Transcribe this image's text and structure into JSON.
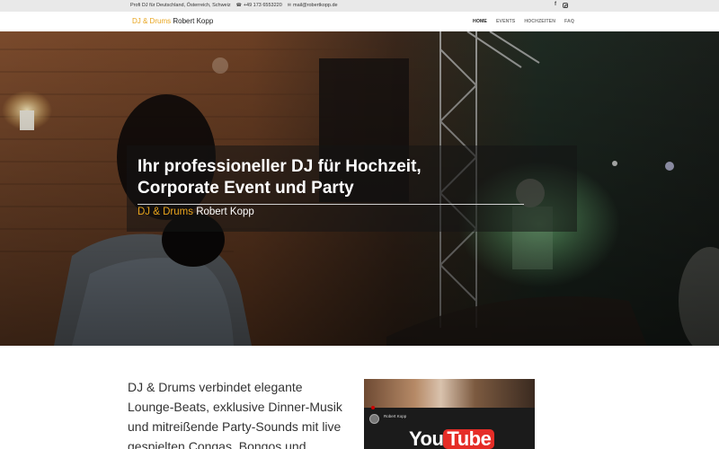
{
  "topbar": {
    "tagline": "Profi DJ für Deutschland, Österreich, Schweiz",
    "phone": "+49 173 6553220",
    "email": "mail@robertkopp.de",
    "phone_icon": "phone-icon",
    "email_icon": "envelope-icon",
    "social": [
      "facebook-icon",
      "instagram-icon"
    ]
  },
  "header": {
    "logo_dj": "DJ & Drums",
    "logo_name": "Robert Kopp",
    "nav": [
      {
        "label": "HOME",
        "active": true
      },
      {
        "label": "EVENTS",
        "active": false
      },
      {
        "label": "HOCHZEITEN",
        "active": false
      },
      {
        "label": "FAQ",
        "active": false
      }
    ]
  },
  "hero": {
    "title": "Ihr professioneller DJ für Hochzeit,\nCorporate Event und Party",
    "sub_dj": "DJ & Drums",
    "sub_name": "Robert Kopp"
  },
  "content": {
    "intro": "DJ & Drums verbindet elegante Lounge-Beats, exklusive Dinner-Musik und mitreißende Party-Sounds mit live gespielten Congas, Bongos und"
  },
  "video": {
    "channel_name": "Robert Kopp",
    "yt_you": "You",
    "yt_tube": "Tube"
  },
  "colors": {
    "accent": "#e8a41c",
    "topbar_bg": "#e9e9e9",
    "hero_overlay": "rgba(20,20,20,0.55)"
  }
}
